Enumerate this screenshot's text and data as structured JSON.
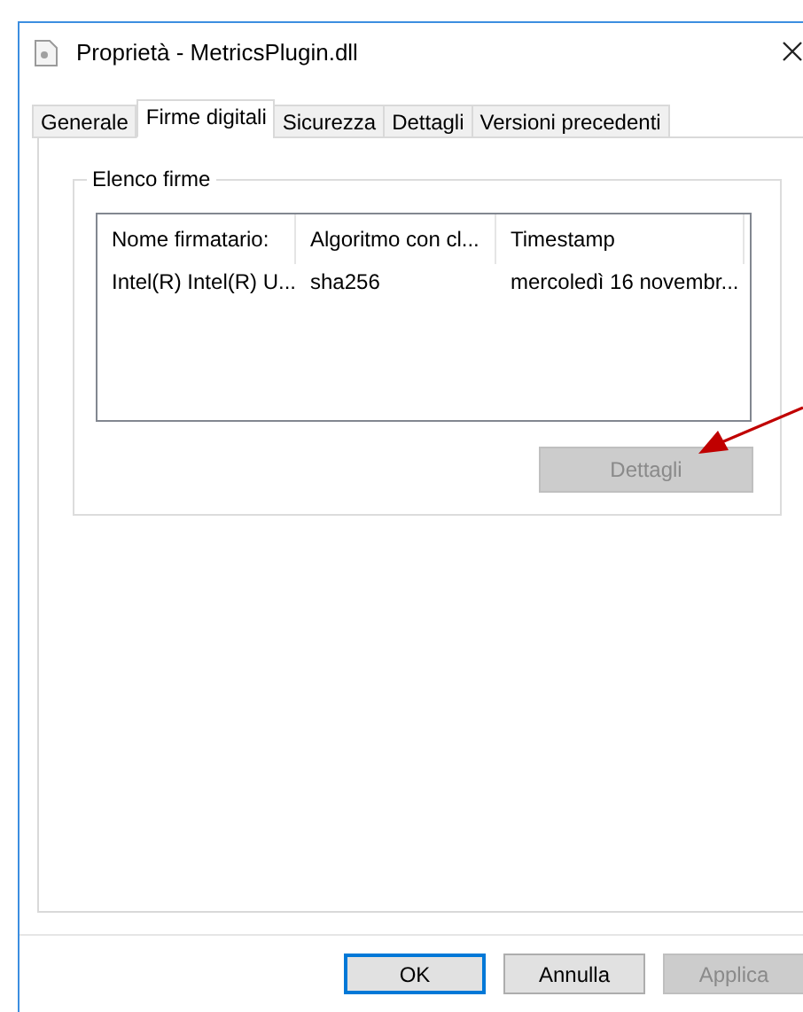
{
  "window": {
    "title": "Proprietà - MetricsPlugin.dll"
  },
  "tabs": [
    {
      "label": "Generale",
      "selected": false
    },
    {
      "label": "Firme digitali",
      "selected": true
    },
    {
      "label": "Sicurezza",
      "selected": false
    },
    {
      "label": "Dettagli",
      "selected": false
    },
    {
      "label": "Versioni precedenti",
      "selected": false
    }
  ],
  "signatures": {
    "group_title": "Elenco firme",
    "columns": [
      "Nome firmatario:",
      "Algoritmo con cl...",
      "Timestamp"
    ],
    "rows": [
      {
        "cells": [
          "Intel(R) Intel(R) U...",
          "sha256",
          "mercoledì 16 novembr..."
        ],
        "selected": false
      }
    ],
    "details_button": {
      "label": "Dettagli",
      "disabled": true
    }
  },
  "buttons": [
    {
      "label": "OK",
      "default": true,
      "disabled": false
    },
    {
      "label": "Annulla",
      "default": false,
      "disabled": false
    },
    {
      "label": "Applica",
      "default": false,
      "disabled": true
    }
  ]
}
